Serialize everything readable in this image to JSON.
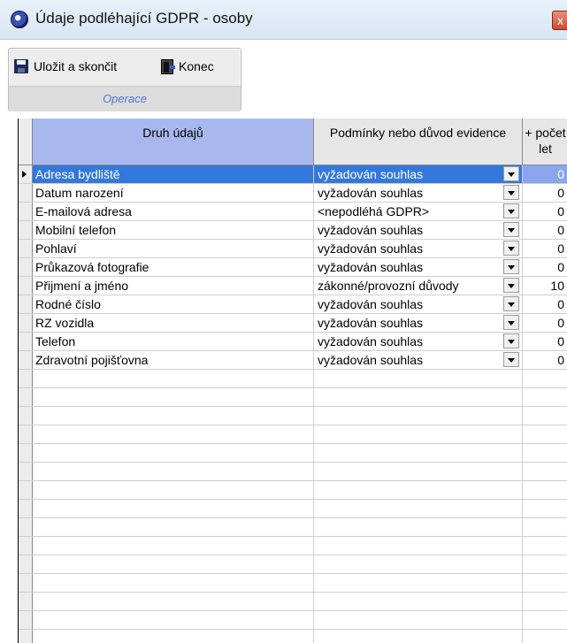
{
  "window": {
    "title": "Údaje podléhající GDPR - osoby",
    "close_label": "x"
  },
  "toolbar": {
    "save_label": "Uložit a skončit",
    "exit_label": "Konec",
    "group_label": "Operace"
  },
  "grid": {
    "columns": [
      "Druh údajů",
      "Podmínky nebo důvod evidence",
      "+ počet let"
    ],
    "rows": [
      {
        "name": "Adresa bydliště",
        "condition": "vyžadován souhlas",
        "years": "0"
      },
      {
        "name": "Datum narození",
        "condition": "vyžadován souhlas",
        "years": "0"
      },
      {
        "name": "E-mailová adresa",
        "condition": "<nepodléhá GDPR>",
        "years": "0"
      },
      {
        "name": "Mobilní telefon",
        "condition": "vyžadován souhlas",
        "years": "0"
      },
      {
        "name": "Pohlaví",
        "condition": "vyžadován souhlas",
        "years": "0"
      },
      {
        "name": "Průkazová fotografie",
        "condition": "vyžadován souhlas",
        "years": "0"
      },
      {
        "name": "Přijmení a jméno",
        "condition": "zákonné/provozní důvody",
        "years": "10"
      },
      {
        "name": "Rodné číslo",
        "condition": "vyžadován souhlas",
        "years": "0"
      },
      {
        "name": "RZ vozidla",
        "condition": "vyžadován souhlas",
        "years": "0"
      },
      {
        "name": "Telefon",
        "condition": "vyžadován souhlas",
        "years": "0"
      },
      {
        "name": "Zdravotní pojišťovna",
        "condition": "vyžadován souhlas",
        "years": "0"
      }
    ]
  },
  "colors": {
    "selection": "#3378dc",
    "header_highlight": "#a8b8ee",
    "group_label": "#5575c8"
  }
}
